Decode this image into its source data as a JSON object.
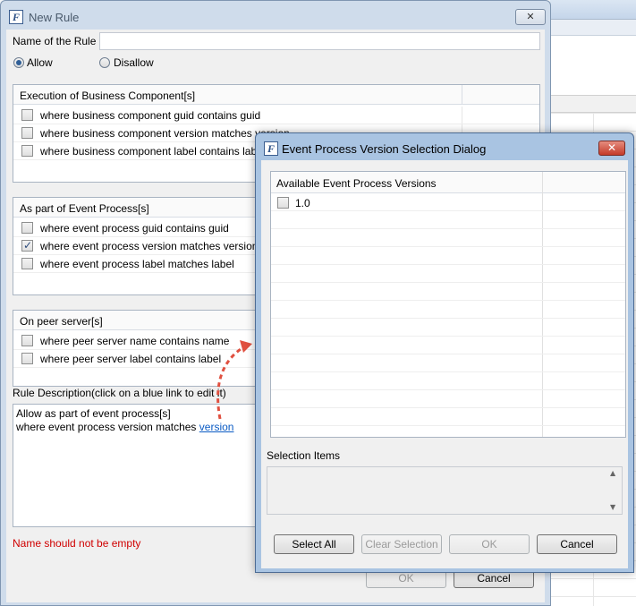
{
  "main_dialog": {
    "title": "New Rule",
    "icon_letter": "F",
    "close_glyph": "✕",
    "name_label": "Name of the Rule",
    "name_value": "",
    "allow_label": "Allow",
    "disallow_label": "Disallow",
    "groups": [
      {
        "header": "Execution of Business Component[s]",
        "rows": [
          {
            "label": "where business component guid contains guid",
            "checked": false
          },
          {
            "label": "where business component version matches version",
            "checked": false
          },
          {
            "label": "where business component label contains label",
            "checked": false
          }
        ]
      },
      {
        "header": "As part of Event Process[s]",
        "rows": [
          {
            "label": "where event process guid contains guid",
            "checked": false
          },
          {
            "label": "where event process version matches version",
            "checked": true
          },
          {
            "label": "where event process label matches label",
            "checked": false
          }
        ]
      },
      {
        "header": "On peer server[s]",
        "rows": [
          {
            "label": "where peer server name contains name",
            "checked": false
          },
          {
            "label": "where peer server label contains label",
            "checked": false
          }
        ]
      }
    ],
    "description_label": "Rule Description(click on a blue link to edit it)",
    "description_line1": "Allow as part of event process[s]",
    "description_line2": "where event process version matches",
    "description_link": "version",
    "error_text": "Name should not be empty",
    "ok_label": "OK",
    "cancel_label": "Cancel"
  },
  "version_dialog": {
    "title": "Event Process Version Selection Dialog",
    "icon_letter": "F",
    "close_glyph": "✕",
    "column_header": "Available Event Process Versions",
    "versions": [
      {
        "label": "1.0",
        "checked": false
      }
    ],
    "selection_items_label": "Selection Items",
    "select_all_label": "Select All",
    "clear_selection_label": "Clear Selection",
    "ok_label": "OK",
    "cancel_label": "Cancel"
  },
  "colors": {
    "accent_link": "#0b5bc4",
    "error": "#d00000",
    "annotation_arrow": "#e05040"
  }
}
